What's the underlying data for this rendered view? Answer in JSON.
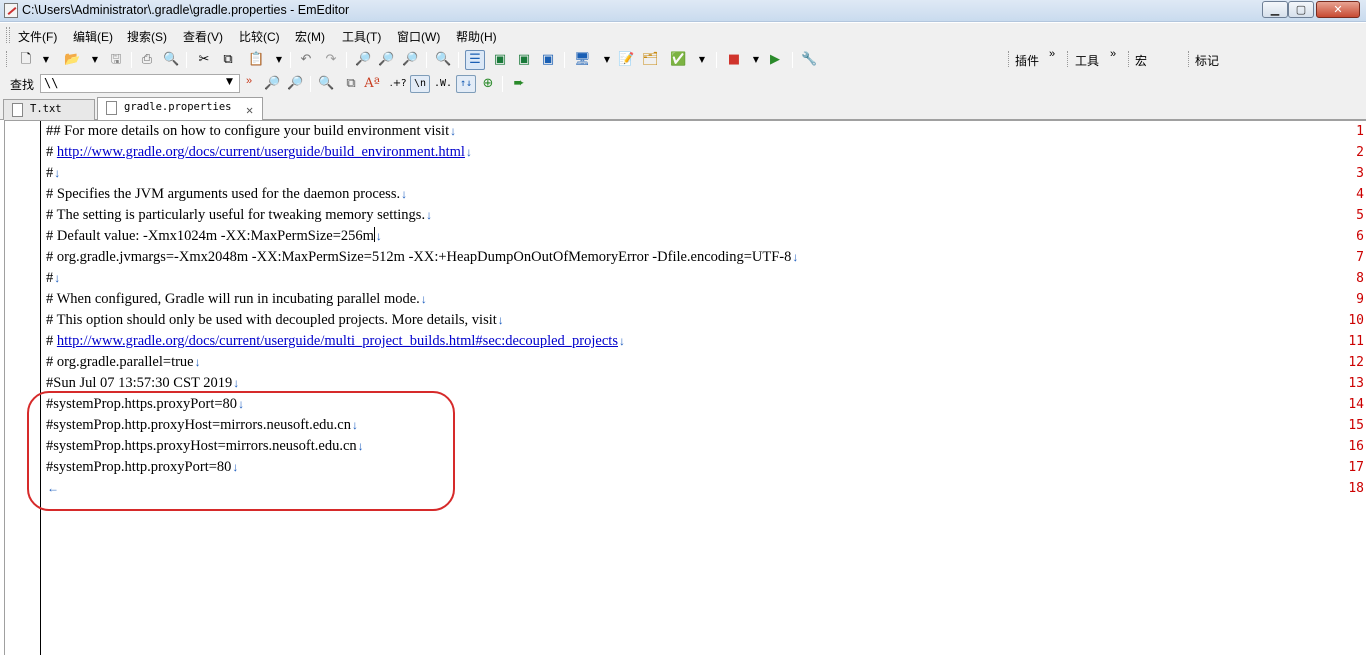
{
  "window": {
    "title": "C:\\Users\\Administrator\\.gradle\\gradle.properties - EmEditor"
  },
  "menu": [
    "文件(F)",
    "编辑(E)",
    "搜索(S)",
    "查看(V)",
    "比较(C)",
    "宏(M)",
    "工具(T)",
    "窗口(W)",
    "帮助(H)"
  ],
  "toolbar": {
    "plugins_label": "插件",
    "tools_label": "工具",
    "macro_label": "宏",
    "marks_label": "标记",
    "more_glyph": "»"
  },
  "findbar": {
    "label": "查找",
    "value": "\\\\",
    "regex_btn": "\\n",
    "word_btn": ".W.",
    "case_btn": "↑↓",
    "next_glyph": "»"
  },
  "tabs": [
    {
      "label": "T.txt",
      "active": false
    },
    {
      "label": "gradle.properties",
      "active": true,
      "close": "✕"
    }
  ],
  "editor": {
    "lines": [
      {
        "n": "1",
        "text": "## For more details on how to configure your build environment visit",
        "eol": "↓"
      },
      {
        "n": "2",
        "pre": "# ",
        "url": "http://www.gradle.org/docs/current/userguide/build_environment.html",
        "eol": "↓"
      },
      {
        "n": "3",
        "text": "#",
        "eol": "↓"
      },
      {
        "n": "4",
        "text": "# Specifies the JVM arguments used for the daemon process.",
        "eol": "↓"
      },
      {
        "n": "5",
        "text": "# The setting is particularly useful for tweaking memory settings.",
        "eol": "↓"
      },
      {
        "n": "6",
        "text": "# Default value: -Xmx1024m -XX:MaxPermSize=256m",
        "eol": "↓",
        "caret": true
      },
      {
        "n": "7",
        "text": "# org.gradle.jvmargs=-Xmx2048m -XX:MaxPermSize=512m -XX:+HeapDumpOnOutOfMemoryError -Dfile.encoding=UTF-8",
        "eol": "↓"
      },
      {
        "n": "8",
        "text": "#",
        "eol": "↓"
      },
      {
        "n": "9",
        "text": "# When configured, Gradle will run in incubating parallel mode.",
        "eol": "↓"
      },
      {
        "n": "10",
        "text": "# This option should only be used with decoupled projects. More details, visit",
        "eol": "↓"
      },
      {
        "n": "11",
        "pre": "# ",
        "url": "http://www.gradle.org/docs/current/userguide/multi_project_builds.html#sec:decoupled_projects",
        "eol": "↓"
      },
      {
        "n": "12",
        "text": "# org.gradle.parallel=true",
        "eol": "↓"
      },
      {
        "n": "13",
        "text": "#Sun Jul 07 13:57:30 CST 2019",
        "eol": "↓"
      },
      {
        "n": "14",
        "text": "#systemProp.https.proxyPort=80",
        "eol": "↓"
      },
      {
        "n": "15",
        "text": "#systemProp.http.proxyHost=mirrors.neusoft.edu.cn",
        "eol": "↓"
      },
      {
        "n": "16",
        "text": "#systemProp.https.proxyHost=mirrors.neusoft.edu.cn",
        "eol": "↓"
      },
      {
        "n": "17",
        "text": "#systemProp.http.proxyPort=80",
        "eol": "↓"
      },
      {
        "n": "18",
        "text": "",
        "eol": "←"
      }
    ]
  },
  "colors": {
    "line_number": "#cc0000",
    "eol_mark": "#2060c0",
    "url": "#0000cc",
    "highlight_box": "#d62a2a"
  }
}
